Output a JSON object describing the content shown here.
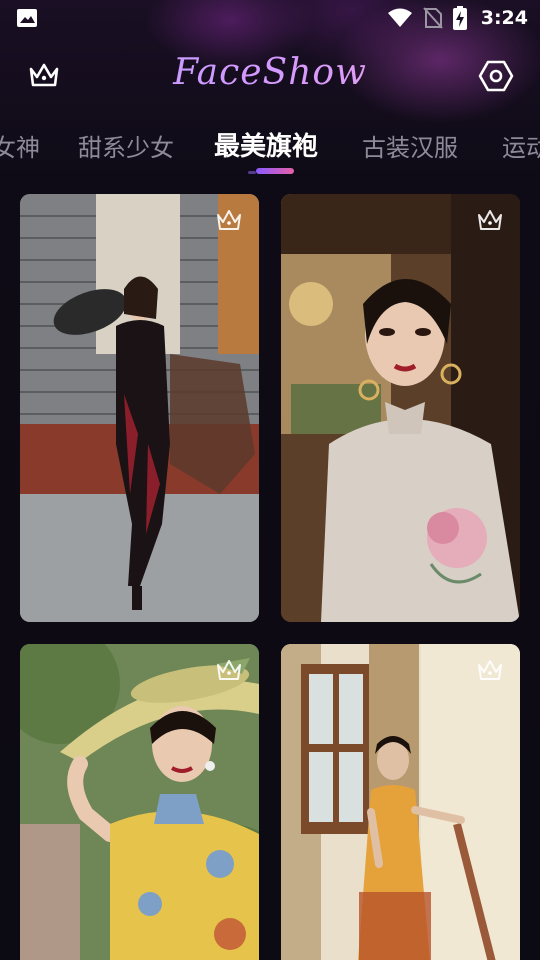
{
  "status_bar": {
    "time": "3:24",
    "icons": [
      "image-icon",
      "wifi-icon",
      "no-sim-icon",
      "battery-charging-icon"
    ]
  },
  "header": {
    "title": "FaceShow",
    "left_icon": "crown-icon",
    "right_icon": "settings-icon"
  },
  "tabs": [
    {
      "label": "女神",
      "active": false
    },
    {
      "label": "甜系少女",
      "active": false
    },
    {
      "label": "最美旗袍",
      "active": true
    },
    {
      "label": "古装汉服",
      "active": false
    },
    {
      "label": "运动",
      "active": false
    }
  ],
  "cards": [
    {
      "badge_icon": "crown-icon",
      "description": "woman in black qipao with fan"
    },
    {
      "badge_icon": "crown-icon",
      "description": "woman in white embroidered qipao"
    },
    {
      "badge_icon": "crown-icon",
      "description": "woman in yellow floral qipao with straw hat"
    },
    {
      "badge_icon": "crown-icon",
      "description": "woman in orange qipao on staircase"
    }
  ],
  "colors": {
    "accent_start": "#8a5cff",
    "accent_end": "#e85fa8",
    "background": "#0c0a14"
  }
}
